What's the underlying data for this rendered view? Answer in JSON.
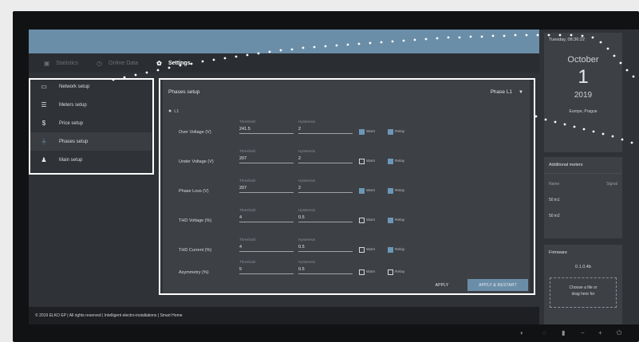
{
  "nav": {
    "statistics": "Statistics",
    "online_data": "Online Data",
    "settings": "Settings"
  },
  "menu": [
    {
      "label": "Network setup",
      "icon": "monitor-icon"
    },
    {
      "label": "Meters setup",
      "icon": "meters-icon"
    },
    {
      "label": "Price setup",
      "icon": "dollar-icon"
    },
    {
      "label": "Phases setup",
      "icon": "phases-icon"
    },
    {
      "label": "Main setup",
      "icon": "user-gear-icon"
    }
  ],
  "panel": {
    "title": "Phases setup",
    "phase_select": "Phase L1",
    "phase_label": "L1",
    "threshold_caption": "Threshold",
    "hysteresis_caption": "Hysteresis",
    "warn_label": "Warn",
    "relay_label": "Relay",
    "rows": [
      {
        "label": "Over Voltage (V)",
        "threshold": "241.5",
        "hysteresis": "2",
        "warn": true,
        "relay": true
      },
      {
        "label": "Under Voltage (V)",
        "threshold": "207",
        "hysteresis": "2",
        "warn": false,
        "relay": true
      },
      {
        "label": "Phase Loss (V)",
        "threshold": "207",
        "hysteresis": "2",
        "warn": true,
        "relay": true
      },
      {
        "label": "THD Voltage (%)",
        "threshold": "4",
        "hysteresis": "0.5",
        "warn": false,
        "relay": true
      },
      {
        "label": "THD Current (%)",
        "threshold": "4",
        "hysteresis": "0.5",
        "warn": false,
        "relay": true
      },
      {
        "label": "Asymmetry (%)",
        "threshold": "5",
        "hysteresis": "0.5",
        "warn": false,
        "relay": false
      }
    ],
    "apply": "APPLY",
    "apply_restart": "APPLY & RESTART"
  },
  "sidebar": {
    "datetime": "Tuesday, 08:36:22",
    "month": "October",
    "day": "1",
    "year": "2019",
    "location": "Europe, Prague",
    "meters_title": "Additional meters",
    "col_name": "Name",
    "col_signal": "Signal",
    "meters": [
      "50 in1",
      "50 in2"
    ],
    "firmware_title": "Firmware",
    "firmware_version": "0.1.0.4b",
    "drop_line1": "Choose a file or",
    "drop_line2": "drag here for"
  },
  "footer": "© 2019 ELKO EP | All rights reserved | Intelligent electro-installations | Smart Home",
  "colors": {
    "accent": "#6b8ea8",
    "panel": "#3d4045",
    "background": "#2f3236"
  }
}
